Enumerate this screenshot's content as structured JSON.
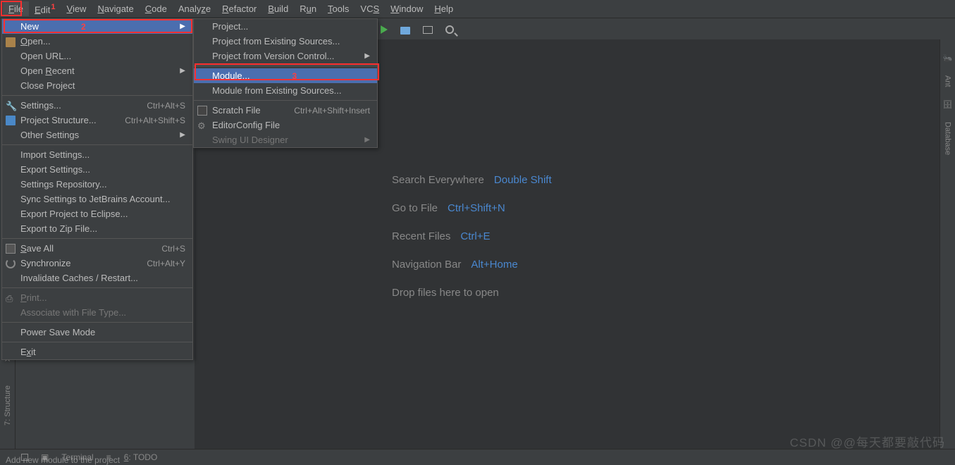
{
  "annotations": {
    "1": "1",
    "2": "2",
    "3": "3"
  },
  "menubar": [
    "File",
    "Edit",
    "View",
    "Navigate",
    "Code",
    "Analyze",
    "Refactor",
    "Build",
    "Run",
    "Tools",
    "VCS",
    "Window",
    "Help"
  ],
  "menubar_mn_index": [
    0,
    0,
    0,
    0,
    0,
    4,
    0,
    0,
    1,
    0,
    2,
    0,
    0
  ],
  "file_menu": {
    "new": "New",
    "open": "Open...",
    "open_url": "Open URL...",
    "open_recent": "Open Recent",
    "close_project": "Close Project",
    "settings": {
      "label": "Settings...",
      "shortcut": "Ctrl+Alt+S"
    },
    "project_structure": {
      "label": "Project Structure...",
      "shortcut": "Ctrl+Alt+Shift+S"
    },
    "other_settings": "Other Settings",
    "import_settings": "Import Settings...",
    "export_settings": "Export Settings...",
    "settings_repository": "Settings Repository...",
    "sync_settings": "Sync Settings to JetBrains Account...",
    "export_eclipse": "Export Project to Eclipse...",
    "export_zip": "Export to Zip File...",
    "save_all": {
      "label": "Save All",
      "shortcut": "Ctrl+S"
    },
    "synchronize": {
      "label": "Synchronize",
      "shortcut": "Ctrl+Alt+Y"
    },
    "invalidate": "Invalidate Caches / Restart...",
    "print": "Print...",
    "assoc_filetype": "Associate with File Type...",
    "power_save": "Power Save Mode",
    "exit": "Exit"
  },
  "new_menu": {
    "project": "Project...",
    "from_existing": "Project from Existing Sources...",
    "from_vcs": "Project from Version Control...",
    "module": "Module...",
    "module_existing": "Module from Existing Sources...",
    "scratch": {
      "label": "Scratch File",
      "shortcut": "Ctrl+Alt+Shift+Insert"
    },
    "editorconfig": "EditorConfig File",
    "swing": "Swing UI Designer"
  },
  "welcome": {
    "rows": [
      {
        "label": "Search Everywhere",
        "key": "Double Shift"
      },
      {
        "label": "Go to File",
        "key": "Ctrl+Shift+N"
      },
      {
        "label": "Recent Files",
        "key": "Ctrl+E"
      },
      {
        "label": "Navigation Bar",
        "key": "Alt+Home"
      }
    ],
    "drop": "Drop files here to open"
  },
  "right_tabs": {
    "ant": "Ant",
    "db": "Database"
  },
  "left_tabs": {
    "structure": "7: Structure"
  },
  "bottom": {
    "terminal": "Terminal",
    "todo": "6: TODO",
    "status": "Add new module to the project"
  },
  "watermark": "CSDN @@每天都要敲代码"
}
